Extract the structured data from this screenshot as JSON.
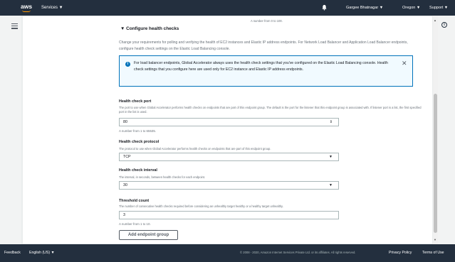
{
  "topbar": {
    "logo": "aws",
    "services_label": "Services ▼",
    "user_label": "Gargee Bhatnagar ▼",
    "region_label": "Oregon ▼",
    "support_label": "Support ▼"
  },
  "main": {
    "top_note": "A number from 0 to 100.",
    "section_title": "▼ Configure health checks",
    "section_desc": "Change your requirements for polling and verifying the health of EC2 instances and Elastic IP address endpoints. For Network Load Balancer and Application Load Balancer endpoints, configure health check settings on the Elastic Load Balancing console.",
    "info_box_text": "For load balancer endpoints, Global Accelerator always uses the health check settings that you've configured on the Elastic Load Balancing console. Health check settings that you configure here are used only for EC2 instance and Elastic IP address endpoints.",
    "health_port": {
      "label": "Health check port",
      "help": "The port to use when Global Accelerator performs health checks on endpoints that are part of this endpoint group. The default is the port for the listener that this endpoint group is associated with. If listener port is a list, the first specified port in the list is used.",
      "value": "80",
      "constraint": "A number from 1 to 65535."
    },
    "health_protocol": {
      "label": "Health check protocol",
      "help": "The protocol to use when Global Accelerator performs health checks on endpoints that are part of this endpoint group.",
      "value": "TCP"
    },
    "health_interval": {
      "label": "Health check interval",
      "help": "The interval, in seconds, between health checks for each endpoint.",
      "value": "30"
    },
    "threshold": {
      "label": "Threshold count",
      "help": "The number of consecutive health checks required before considering an unhealthy target healthy or a healthy target unhealthy.",
      "value": "3",
      "constraint": "A number from 1 to 10."
    },
    "add_button": "Add endpoint group"
  },
  "footer": {
    "feedback": "Feedback",
    "language": "English (US) ▼",
    "copyright": "© 2008 - 2020, Amazon Internet Services Private Ltd. or its affiliates. All rights reserved.",
    "privacy": "Privacy Policy",
    "terms": "Terms of Use"
  },
  "icons": {
    "info": "i",
    "close": "✕",
    "caret_select": "▼",
    "caret_stepper": "⇕"
  }
}
